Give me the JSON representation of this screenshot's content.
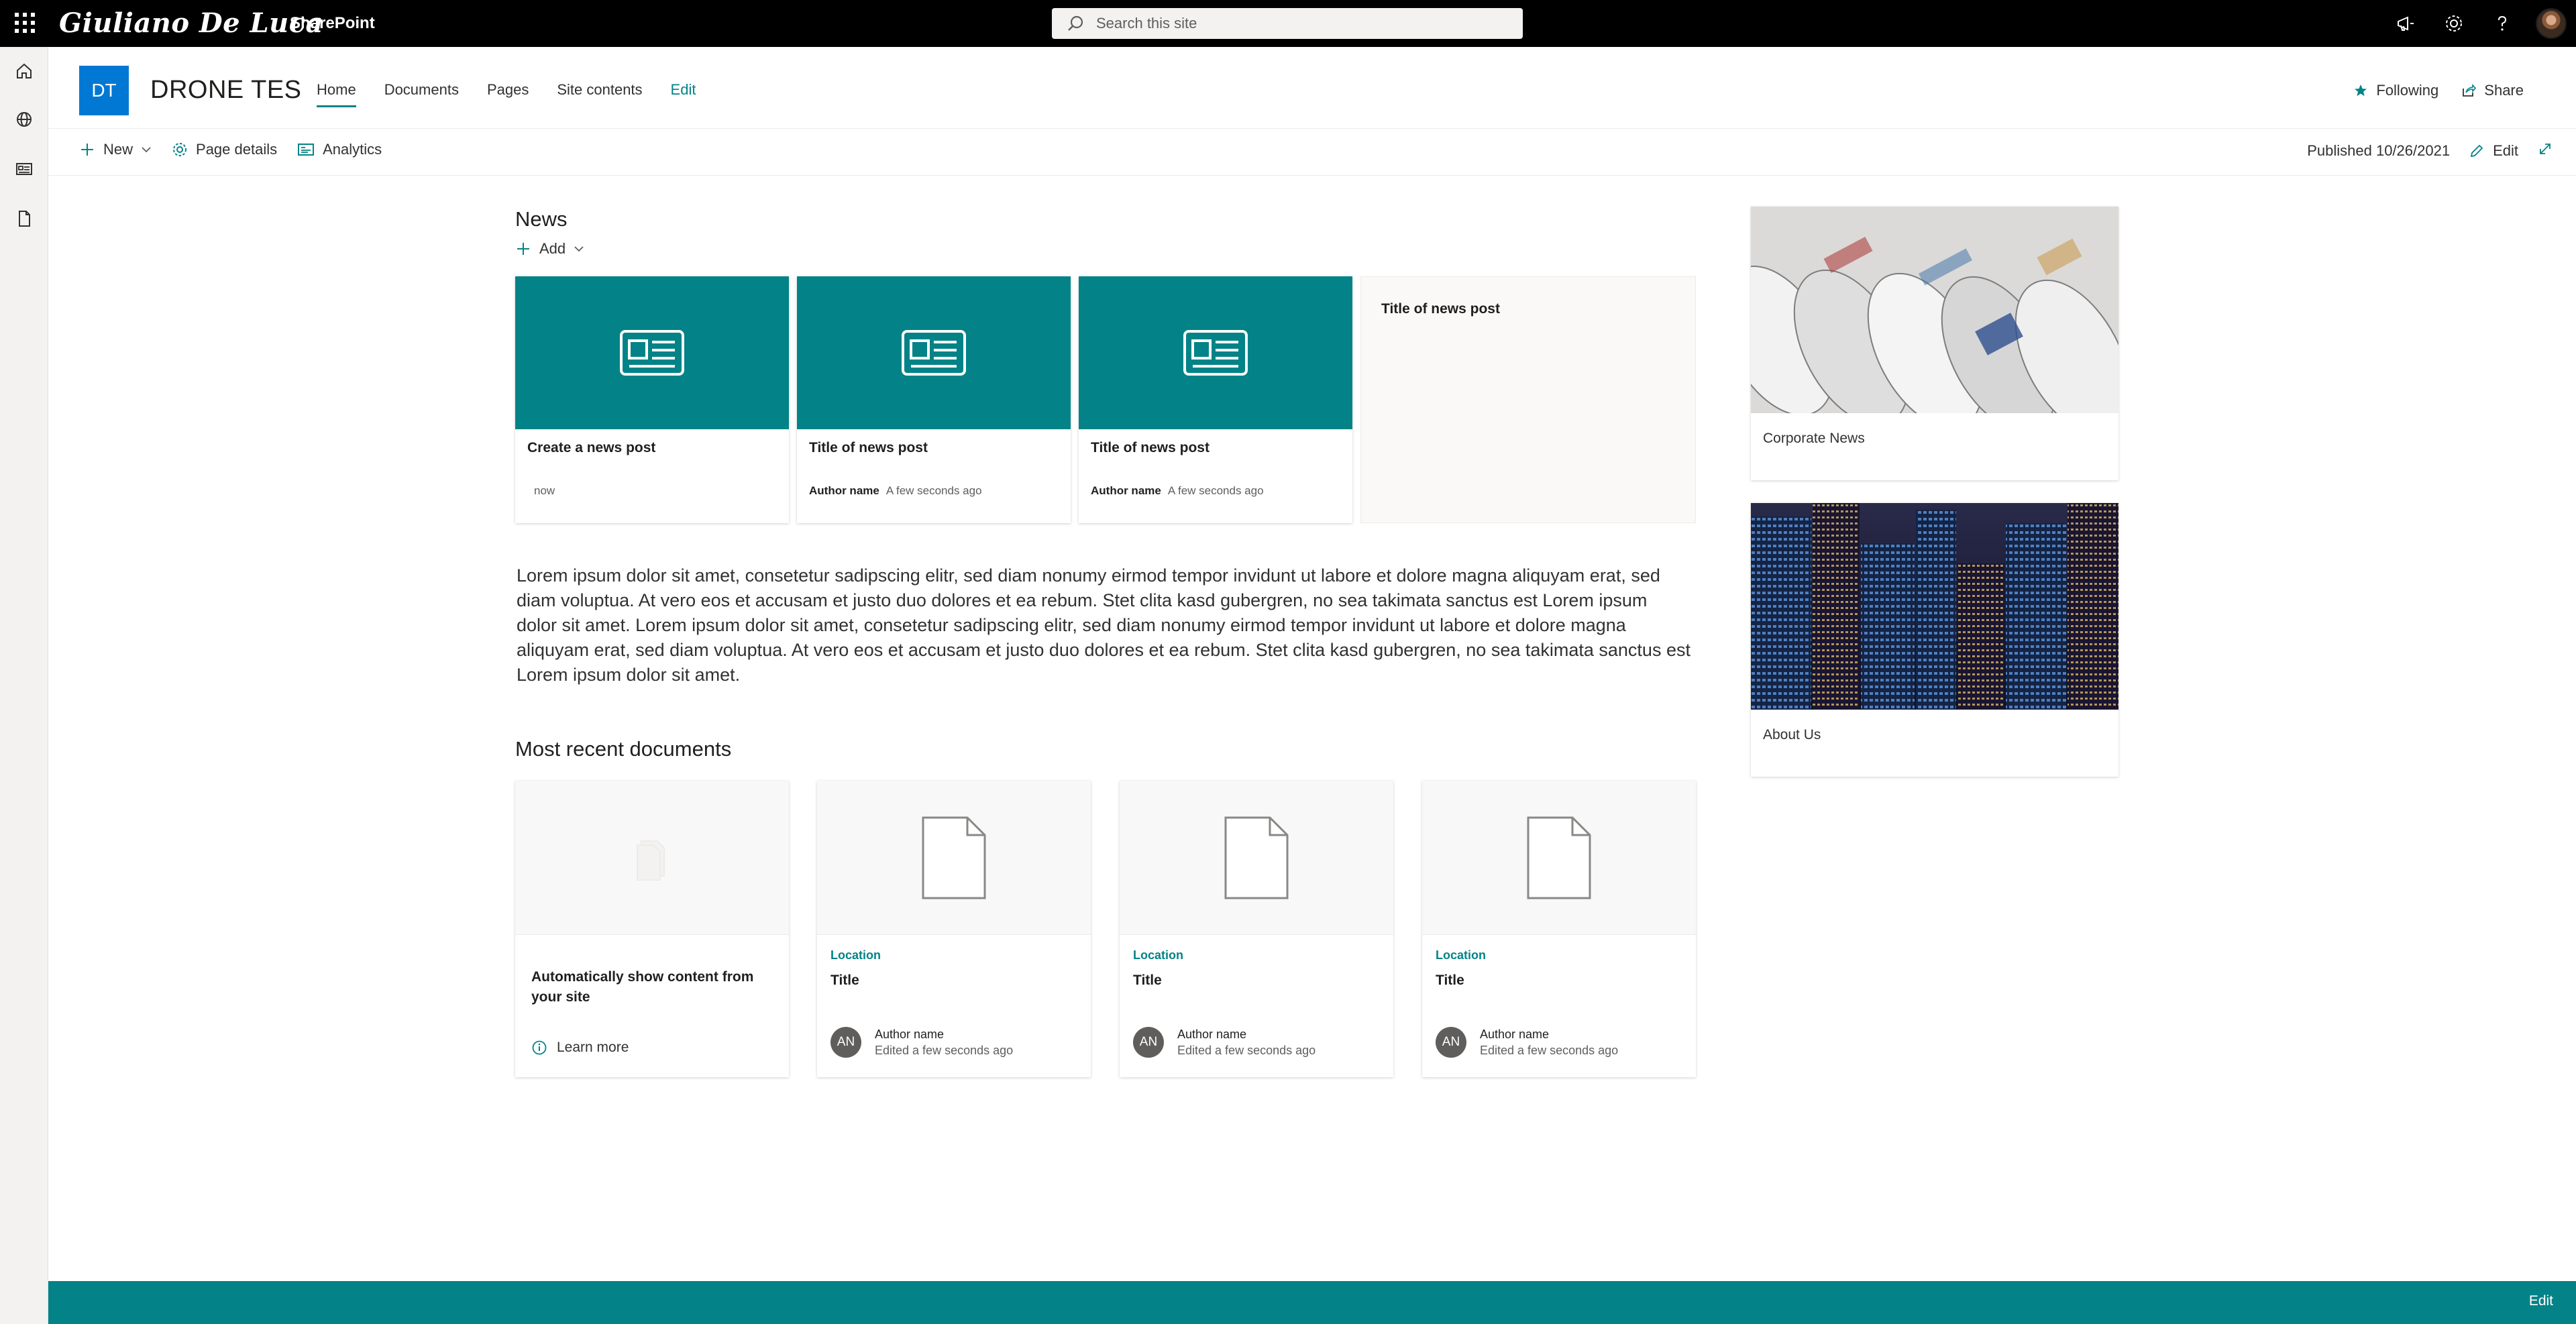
{
  "suite": {
    "brand": "Giuliano De Luca",
    "app_name": "SharePoint",
    "search_placeholder": "Search this site",
    "icons": [
      "app-launcher-icon",
      "search-icon",
      "megaphone-icon",
      "gear-icon",
      "help-icon",
      "user-avatar"
    ]
  },
  "rail": {
    "items": [
      "home-icon",
      "globe-icon",
      "news-icon",
      "document-icon"
    ]
  },
  "site": {
    "logo_initials": "DT",
    "title": "DRONE TES",
    "nav": [
      {
        "label": "Home",
        "active": true
      },
      {
        "label": "Documents"
      },
      {
        "label": "Pages"
      },
      {
        "label": "Site contents"
      },
      {
        "label": "Edit",
        "edit": true
      }
    ],
    "following": "Following",
    "share": "Share"
  },
  "commandbar": {
    "new": "New",
    "page_details": "Page details",
    "analytics": "Analytics",
    "published": "Published 10/26/2021",
    "edit": "Edit"
  },
  "news": {
    "heading": "News",
    "add": "Add",
    "cards": [
      {
        "title": "Create a news post",
        "author": "",
        "time": "now"
      },
      {
        "title": "Title of news post",
        "author": "Author name",
        "time": "A few seconds ago"
      },
      {
        "title": "Title of news post",
        "author": "Author name",
        "time": "A few seconds ago"
      }
    ],
    "plain_card_title": "Title of news post"
  },
  "body_text": "Lorem ipsum dolor sit amet, consetetur sadipscing elitr, sed diam nonumy eirmod tempor invidunt ut labore et dolore magna aliquyam erat, sed diam voluptua. At vero eos et accusam et justo duo dolores et ea rebum. Stet clita kasd gubergren, no sea takimata sanctus est Lorem ipsum dolor sit amet. Lorem ipsum dolor sit amet, consetetur sadipscing elitr, sed diam nonumy eirmod tempor invidunt ut labore et dolore magna aliquyam erat, sed diam voluptua. At vero eos et accusam et justo duo dolores et ea rebum. Stet clita kasd gubergren, no sea takimata sanctus est Lorem ipsum dolor sit amet.",
  "documents": {
    "heading": "Most recent documents",
    "empty_card": {
      "title": "Automatically show content from your site",
      "learn_more": "Learn more"
    },
    "cards": [
      {
        "location": "Location",
        "title": "Title",
        "initials": "AN",
        "author": "Author name",
        "edited": "Edited a few seconds ago"
      },
      {
        "location": "Location",
        "title": "Title",
        "initials": "AN",
        "author": "Author name",
        "edited": "Edited a few seconds ago"
      },
      {
        "location": "Location",
        "title": "Title",
        "initials": "AN",
        "author": "Author name",
        "edited": "Edited a few seconds ago"
      }
    ]
  },
  "quicklinks": [
    {
      "label": "Corporate News"
    },
    {
      "label": "About Us"
    }
  ],
  "footer": {
    "edit": "Edit"
  },
  "colors": {
    "accent": "#038387",
    "site_logo": "#0078d4",
    "suitebar": "#000000"
  }
}
